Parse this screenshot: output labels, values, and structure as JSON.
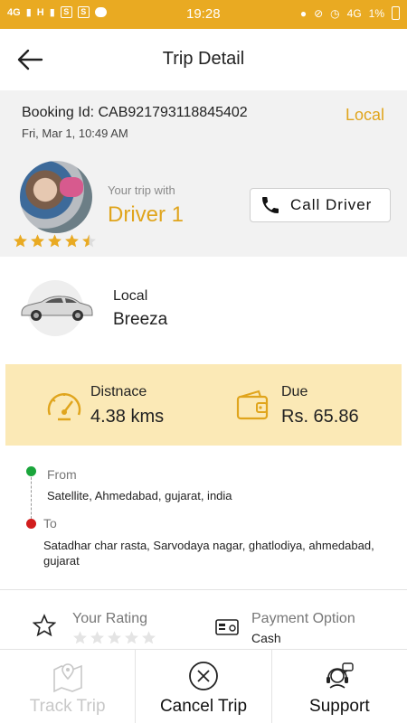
{
  "status_bar": {
    "network_left": "4G",
    "network_h": "H",
    "time": "19:28",
    "network_right": "4G",
    "battery": "1%"
  },
  "header": {
    "title": "Trip Detail"
  },
  "booking": {
    "id_text": "Booking Id: CAB921793118845402",
    "datetime": "Fri, Mar 1, 10:49 AM",
    "trip_type": "Local",
    "trip_with_label": "Your trip with",
    "driver_name": "Driver 1",
    "driver_rating": 4.5,
    "call_button_label": "Call Driver"
  },
  "vehicle": {
    "category": "Local",
    "model": "Breeza"
  },
  "trip_info": {
    "distance_label": "Distnace",
    "distance_value": "4.38 kms",
    "due_label": "Due",
    "due_value": "Rs. 65.86"
  },
  "route": {
    "from_label": "From",
    "from_address": "Satellite, Ahmedabad, gujarat, india",
    "to_label": "To",
    "to_address": "Satadhar char rasta, Sarvodaya nagar, ghatlodiya, ahmedabad, gujarat"
  },
  "feedback": {
    "rating_label": "Your Rating",
    "rating_value": 0,
    "payment_label": "Payment Option",
    "payment_value": "Cash"
  },
  "actions": {
    "track_label": "Track Trip",
    "cancel_label": "Cancel Trip",
    "support_label": "Support"
  },
  "colors": {
    "accent": "#e9aa22",
    "highlight_band": "#fbe9b6",
    "from_dot": "#1aa53b",
    "to_dot": "#d11d1d"
  },
  "icons": {
    "back": "arrow-left-icon",
    "call": "phone-icon",
    "distance": "speedometer-icon",
    "due": "wallet-icon",
    "rating": "star-outline-icon",
    "payment": "card-icon",
    "track": "map-pin-icon",
    "cancel": "close-circle-icon",
    "support": "headset-icon"
  }
}
